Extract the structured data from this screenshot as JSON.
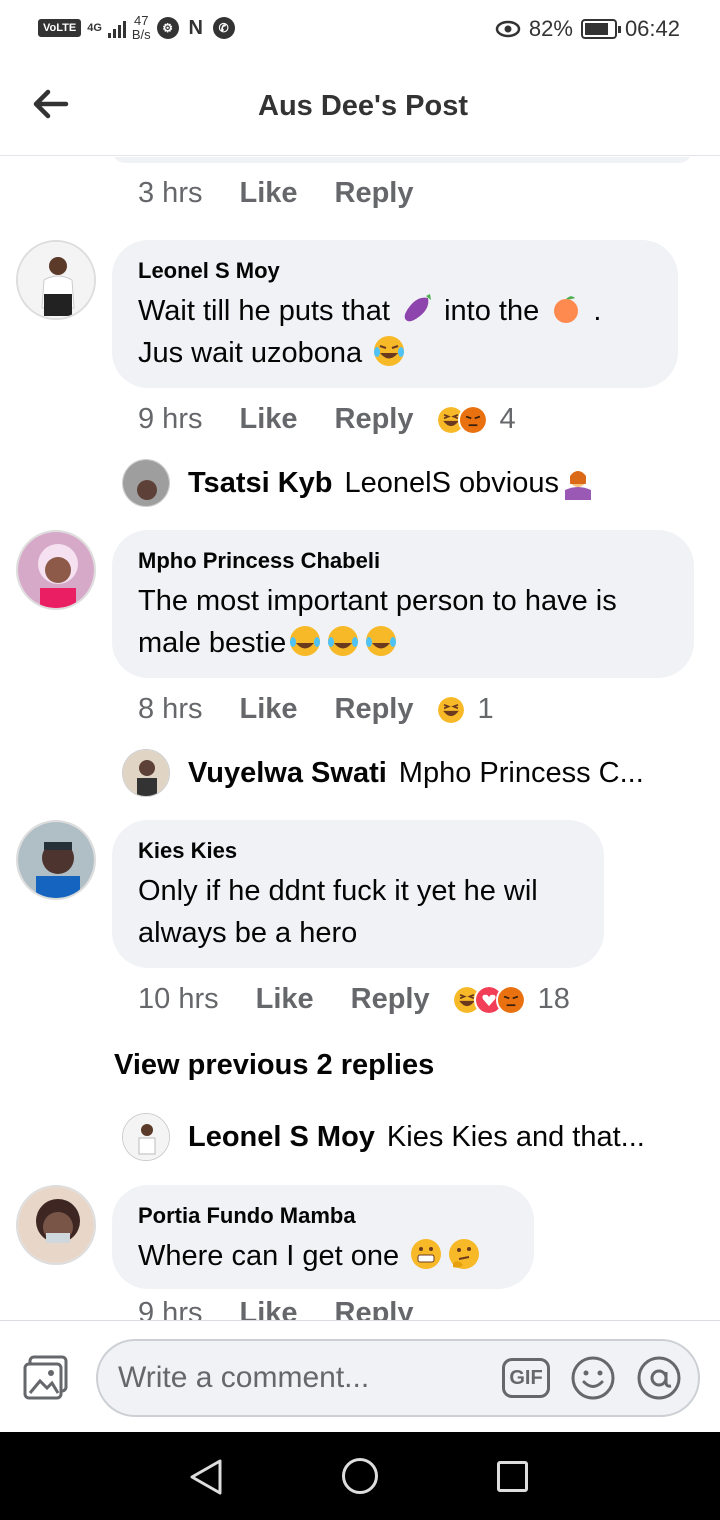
{
  "status_bar": {
    "network_badge": "VoLTE",
    "signal_type": "4G",
    "data_speed_value": "47",
    "data_speed_unit": "B/s",
    "battery_percent": "82%",
    "battery_level": 0.82,
    "time": "06:42"
  },
  "header": {
    "title": "Aus Dee's Post"
  },
  "top_comment_meta": {
    "time": "3 hrs",
    "like": "Like",
    "reply": "Reply"
  },
  "comments": [
    {
      "name": "Leonel S Moy",
      "text_a": "Wait till he puts that ",
      "text_b": " into the ",
      "text_c": " .",
      "text_d": "Jus wait uzobona ",
      "time": "9 hrs",
      "like": "Like",
      "reply": "Reply",
      "reaction_count": "4",
      "reactions": [
        "haha-icon",
        "angry-icon"
      ],
      "reply_preview": {
        "name": "Tsatsi Kyb",
        "text": "LeonelS  obvious "
      }
    },
    {
      "name": "Mpho Princess Chabeli",
      "text_a": "The most important person to have is",
      "text_b": "male bestie",
      "time": "8 hrs",
      "like": "Like",
      "reply": "Reply",
      "reaction_count": "1",
      "reactions": [
        "haha-icon"
      ],
      "reply_preview": {
        "name": "Vuyelwa Swati",
        "text": "Mpho Princess C..."
      }
    },
    {
      "name": "Kies Kies",
      "text_a": "Only if he ddnt fuck it yet he wil",
      "text_b": "always be a hero",
      "time": "10 hrs",
      "like": "Like",
      "reply": "Reply",
      "reaction_count": "18",
      "reactions": [
        "haha-icon",
        "love-icon",
        "angry-icon"
      ],
      "view_previous": "View previous 2 replies",
      "reply_preview": {
        "name": "Leonel S Moy",
        "text": "Kies Kies and that..."
      }
    },
    {
      "name": "Portia Fundo Mamba",
      "text_a": "Where can I get one ",
      "time": "9 hrs",
      "like": "Like",
      "reply": "Reply"
    }
  ],
  "composer": {
    "placeholder": "Write a comment...",
    "gif_label": "GIF"
  },
  "colors": {
    "bubble_bg": "#f0f2f5",
    "meta_text": "#65676b",
    "haha_yellow": "#f7b928",
    "love_pink": "#f33e58",
    "angry_orange": "#e9710f"
  }
}
